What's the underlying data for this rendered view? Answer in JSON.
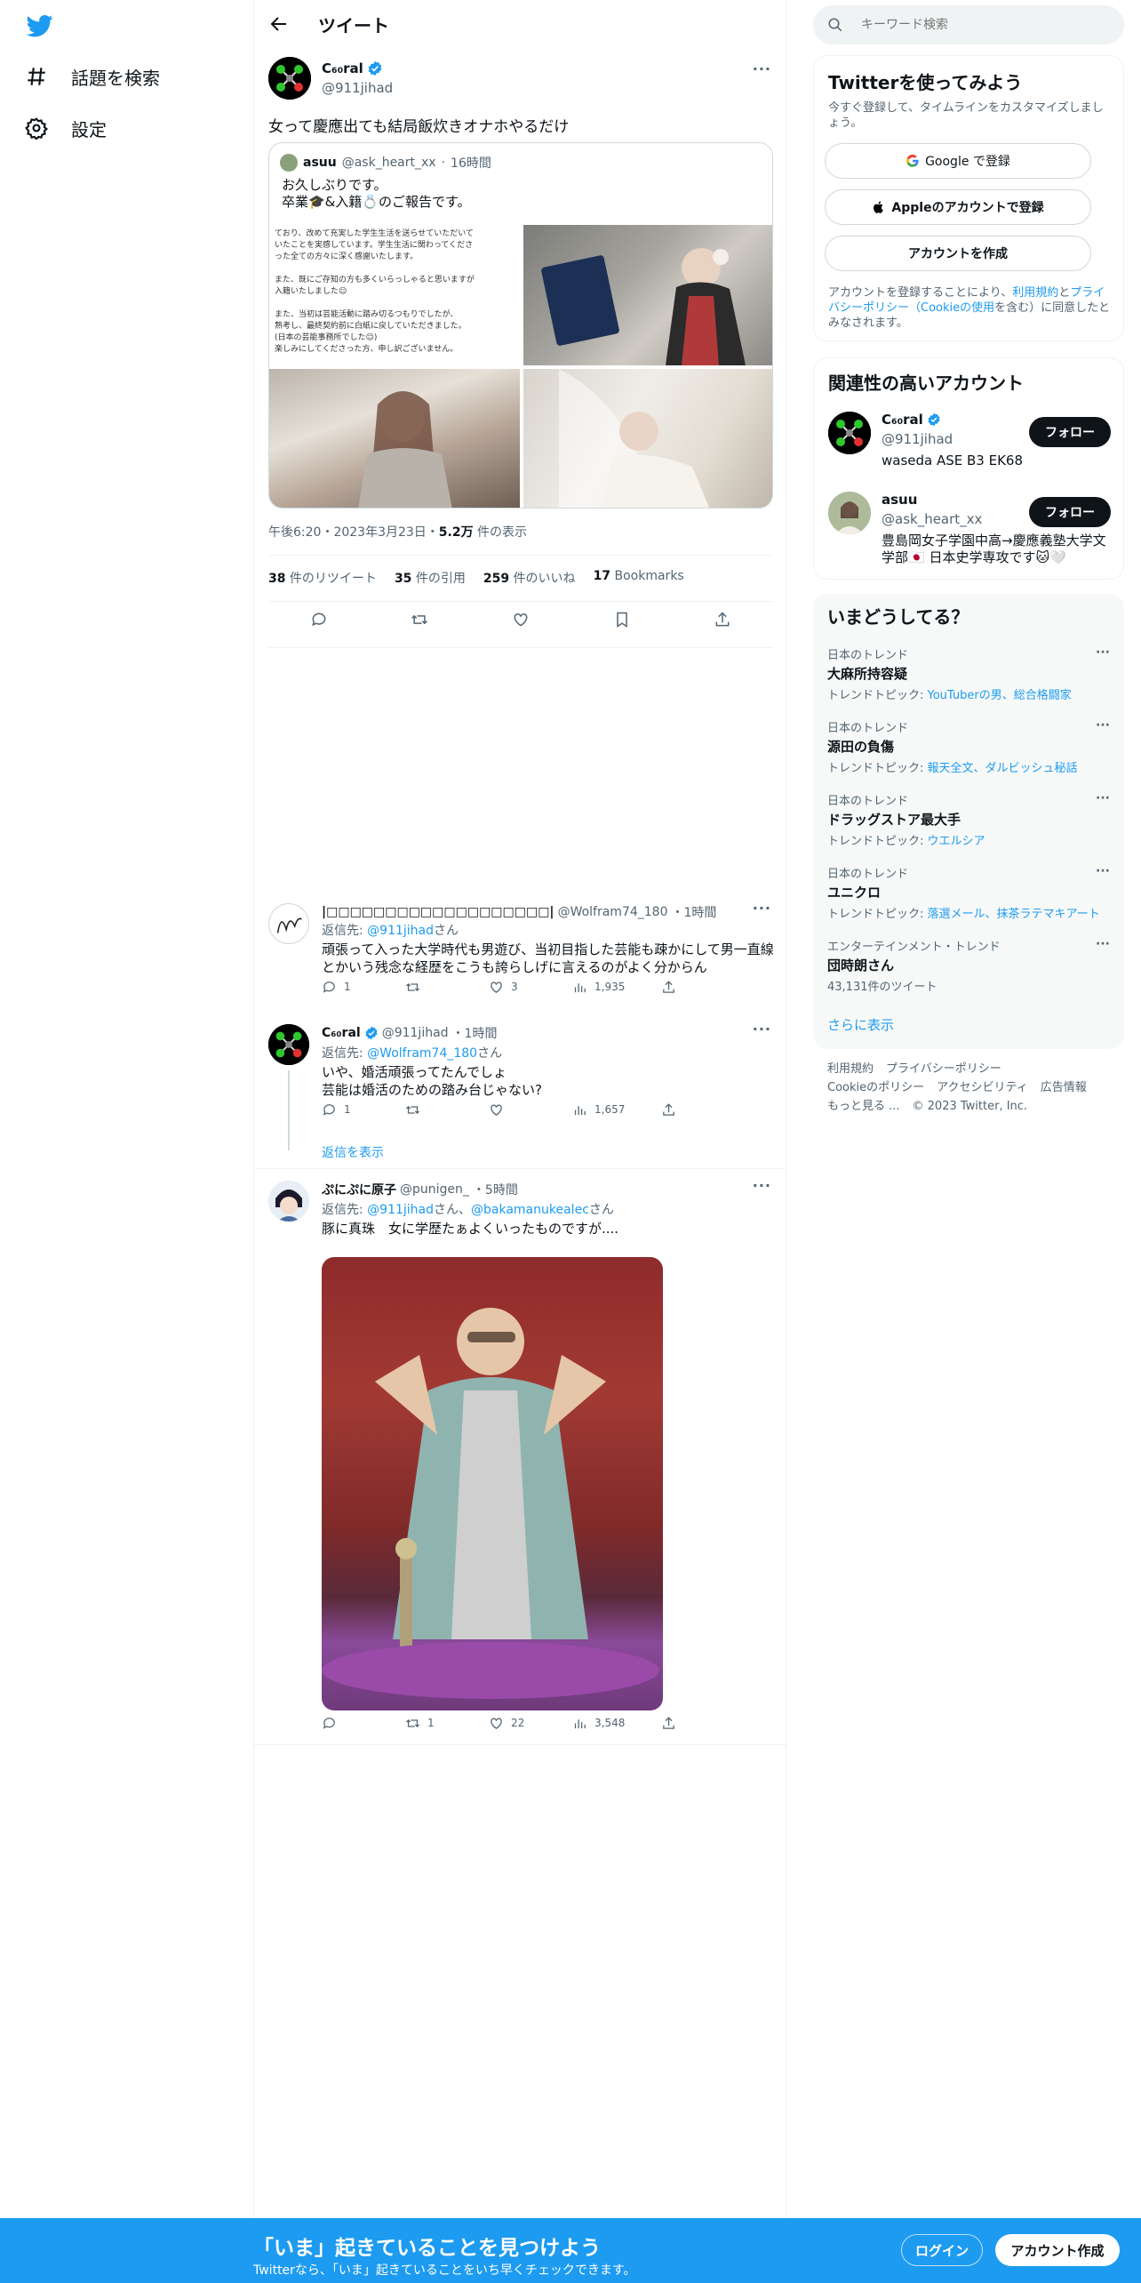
{
  "nav": {
    "explore_label": "話題を検索",
    "settings_label": "設定"
  },
  "header": {
    "title": "ツイート"
  },
  "main_tweet": {
    "name": "C₆₀ral",
    "handle": "@911jihad",
    "text": "女って慶應出ても結局飯炊きオナホやるだけ",
    "quote": {
      "name": "asuu",
      "handle": "@ask_heart_xx",
      "time": "16時間",
      "text_line1": "お久しぶりです。",
      "text_line2": "卒業🎓&入籍💍のご報告です。",
      "note_lines": [
        "ており、改めて充実した学生生活を送らせていただいて",
        "いたことを実感しています。学生生活に関わってくださ",
        "った全ての方々に深く感謝いたします。",
        "",
        "また、既にご存知の方も多くいらっしゃると思いますが",
        "入籍いたしました☺",
        "",
        "また、当初は芸能活動に踏み切るつもりでしたが、",
        "熟考し、最終契約前に白紙に戻していただきました。",
        "(日本の芸能事務所でした☺)",
        "楽しみにしてくださった方、申し訳ございません。"
      ]
    },
    "time": "午後6:20・2023年3月23日・",
    "views": "5.2万",
    "views_label": " 件の表示",
    "stats": {
      "retweets": "38",
      "retweets_label": " 件のリツイート",
      "quotes": "35",
      "quotes_label": " 件の引用",
      "likes": "259",
      "likes_label": " 件のいいね",
      "bookmarks": "17",
      "bookmarks_label": " Bookmarks"
    }
  },
  "replies": [
    {
      "name": "|□□□□□□□□□□□□□□□□□□□|",
      "handle": "@Wolfram74_180",
      "time": "・1時間",
      "to_prefix": "返信先: ",
      "to": "@911jihad",
      "to_suffix": "さん",
      "body": "頑張って入った大学時代も男遊び、当初目指した芸能も疎かにして男一直線とかいう残念な経歴をこうも誇らしげに言えるのがよく分からん",
      "replies": "1",
      "retweets": "",
      "likes": "3",
      "views": "1,935"
    },
    {
      "name": "C₆₀ral",
      "handle": "@911jihad",
      "time": "・1時間",
      "to_prefix": "返信先: ",
      "to": "@Wolfram74_180",
      "to_suffix": "さん",
      "body_line1": "いや、婚活頑張ってたんでしょ",
      "body_line2": "芸能は婚活のための踏み台じゃない?",
      "replies": "1",
      "retweets": "",
      "likes": "",
      "views": "1,657",
      "show_replies": "返信を表示"
    },
    {
      "name": "ぷにぷに原子",
      "handle": "@punigen_",
      "time": "・5時間",
      "to_prefix": "返信先: ",
      "to": "@911jihad",
      "to_mid": "さん、",
      "to2": "@bakamanukealec",
      "to_suffix": "さん",
      "body": "豚に真珠　女に学歴たぁよくいったものですが....",
      "replies": "",
      "retweets": "1",
      "likes": "22",
      "views": "3,548"
    }
  ],
  "search": {
    "placeholder": "キーワード検索"
  },
  "signup_panel": {
    "title": "Twitterを使ってみよう",
    "subtitle": "今すぐ登録して、タイムラインをカスタマイズしましょう。",
    "google": "Google で登録",
    "apple": "Appleのアカウントで登録",
    "create": "アカウントを作成",
    "legal_prefix": "アカウントを登録することにより、",
    "legal_terms": "利用規約",
    "legal_and": "と",
    "legal_privacy": "プライバシーポリシー",
    "legal_cookie": "（Cookieの使用",
    "legal_suffix": "を含む）に同意したとみなされます。"
  },
  "related": {
    "title": "関連性の高いアカウント",
    "follow": "フォロー",
    "accounts": [
      {
        "name": "C₆₀ral",
        "handle": "@911jihad",
        "bio": "waseda ASE B3 EK68"
      },
      {
        "name": "asuu",
        "handle": "@ask_heart_xx",
        "bio": "豊島岡女子学園中高→慶應義塾大学文学部🇯🇵 日本史学専攻です🐱🤍"
      }
    ]
  },
  "trends": {
    "title": "いまどうしてる？",
    "items": [
      {
        "cat": "日本のトレンド",
        "name": "大麻所持容疑",
        "topic_prefix": "トレンドトピック: ",
        "topic": "YouTuberの男、総合格闘家"
      },
      {
        "cat": "日本のトレンド",
        "name": "源田の負傷",
        "topic_prefix": "トレンドトピック: ",
        "topic": "報天全文、ダルビッシュ秘話"
      },
      {
        "cat": "日本のトレンド",
        "name": "ドラッグストア最大手",
        "topic_prefix": "トレンドトピック: ",
        "topic": "ウエルシア"
      },
      {
        "cat": "日本のトレンド",
        "name": "ユニクロ",
        "topic_prefix": "トレンドトピック: ",
        "topic": "落選メール、抹茶ラテマキアート"
      },
      {
        "cat": "エンターテインメント・トレンド",
        "name": "団時朗さん",
        "topic_prefix": "",
        "topic": "43,131件のツイート"
      }
    ],
    "more": "さらに表示"
  },
  "footer": {
    "line1": [
      "利用規約",
      "プライバシーポリシー"
    ],
    "line2": [
      "Cookieのポリシー",
      "アクセシビリティ",
      "広告情報"
    ],
    "line3": [
      "もっと見る ...",
      "© 2023 Twitter, Inc."
    ]
  },
  "bottom_bar": {
    "title": "「いま」起きていることを見つけよう",
    "subtitle": "Twitterなら、「いま」起きていることをいち早くチェックできます。",
    "login": "ログイン",
    "signup": "アカウント作成"
  },
  "colors": {
    "accent": "#1d9bf0",
    "text": "#0f1419",
    "muted": "#536471"
  }
}
